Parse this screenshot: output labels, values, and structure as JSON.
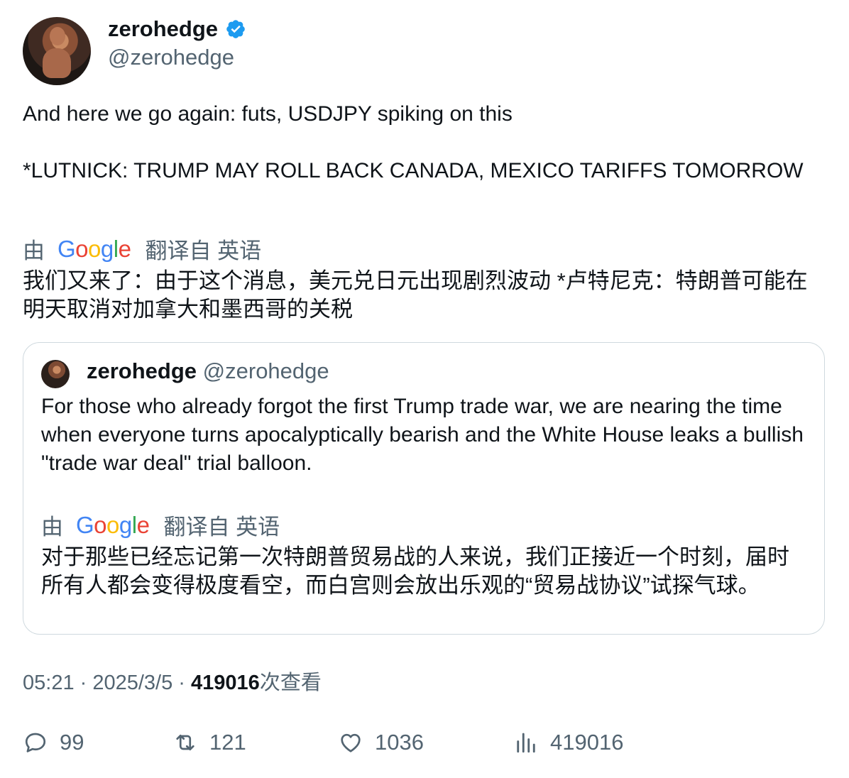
{
  "author": {
    "name": "zerohedge",
    "handle": "@zerohedge"
  },
  "tweet": {
    "text": "And here we go again: futs, USDJPY spiking on this\n\n*LUTNICK: TRUMP MAY ROLL BACK CANADA, MEXICO TARIFFS TOMORROW",
    "translate_by": "由",
    "translate_from": "翻译自 英语",
    "translation": "我们又来了：由于这个消息，美元兑日元出现剧烈波动 *卢特尼克：特朗普可能在明天取消对加拿大和墨西哥的关税"
  },
  "quote": {
    "name": "zerohedge",
    "handle": "@zerohedge",
    "text": "For those who already forgot the first Trump trade war, we are nearing the time when everyone turns apocalyptically bearish and the White House leaks a bullish \"trade war deal\" trial balloon.",
    "translate_by": "由",
    "translate_from": "翻译自 英语",
    "translation": "对于那些已经忘记第一次特朗普贸易战的人来说，我们正接近一个时刻，届时所有人都会变得极度看空，而白宫则会放出乐观的“贸易战协议”试探气球。"
  },
  "meta": {
    "time": "05:21",
    "sep1": " · ",
    "date": "2025/3/5",
    "sep2": " · ",
    "views": "419016",
    "views_label": "次查看"
  },
  "actions": {
    "replies": "99",
    "retweets": "121",
    "likes": "1036",
    "views": "419016"
  },
  "icons": {
    "verified": "verified-badge-icon",
    "reply": "reply-icon",
    "retweet": "retweet-icon",
    "like": "heart-icon",
    "views": "views-icon"
  },
  "colors": {
    "verified": "#1d9bf0",
    "secondary_text": "#536471",
    "primary_text": "#0f1419",
    "border": "#cfd9de"
  }
}
